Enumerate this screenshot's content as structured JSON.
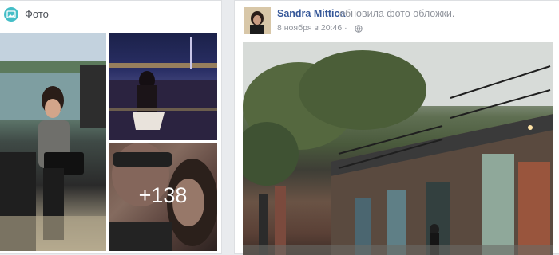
{
  "photos": {
    "title": "Фото",
    "more_count": "+138",
    "icon": "photos-icon",
    "accent": "#44bec7"
  },
  "post": {
    "author": "Sandra Mittica",
    "action": "обновила фото обложки.",
    "timestamp": "8 ноября в 20:46 ·",
    "privacy_icon": "globe-icon",
    "link_color": "#365899"
  }
}
